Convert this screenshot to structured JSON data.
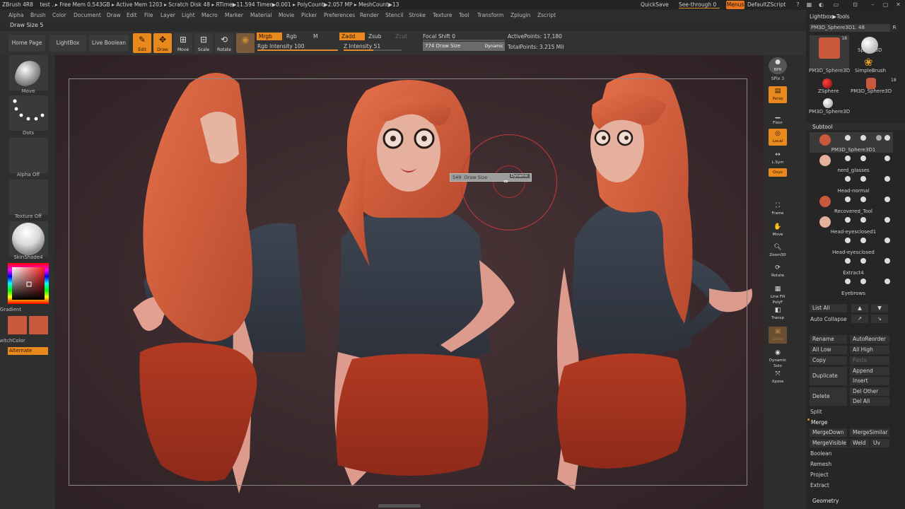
{
  "titlebar": {
    "app": "ZBrush 4R8",
    "project": "test",
    "free_mem": "Free Mem 0.543GB",
    "active_mem": "Active Mem 1203",
    "scratch": "Scratch Disk 48",
    "rtime": "RTime▶11.594 Timer▶0.001",
    "polycount": "PolyCount▶2.057 MP",
    "meshcount": "MeshCount▶13",
    "quicksave": "QuickSave",
    "see_through": "See-through  0",
    "menus": "Menus",
    "default_script": "DefaultZScript"
  },
  "menubar": [
    "Alpha",
    "Brush",
    "Color",
    "Document",
    "Draw",
    "Edit",
    "File",
    "Layer",
    "Light",
    "Macro",
    "Marker",
    "Material",
    "Movie",
    "Picker",
    "Preferences",
    "Render",
    "Stencil",
    "Stroke",
    "Texture",
    "Tool",
    "Transform",
    "Zplugin",
    "Zscript"
  ],
  "info": {
    "draw_size": "Draw Size 5"
  },
  "shelf": {
    "home": "Home Page",
    "lightbox": "LightBox",
    "live_boolean": "Live Boolean",
    "edit": "Edit",
    "draw": "Draw",
    "move": "Move",
    "scale": "Scale",
    "rotate": "Rotate",
    "mrgb": "Mrgb",
    "rgb": "Rgb",
    "m": "M",
    "zadd": "Zadd",
    "zsub": "Zsub",
    "zcut": "Zcut",
    "rgb_intensity": "Rgb Intensity 100",
    "rgb_intensity_value": 100,
    "z_intensity": "Z Intensity 51",
    "z_intensity_value": 51,
    "focal_shift": "Focal Shift  0",
    "draw_size_field": "774  Draw Size",
    "dynamic": "Dynamic",
    "active_points": "ActivePoints: 17,180",
    "total_points": "TotalPoints: 3.215 Mil"
  },
  "leftcol": {
    "move": "Move",
    "dots": "Dots",
    "alpha": "Alpha Off",
    "texture": "Texture Off",
    "material": "SkinShade4",
    "gradient": "Gradient",
    "switch_color": "SwitchColor",
    "alternate": "Alternate"
  },
  "popup": {
    "value": "549",
    "label": "Draw Size",
    "dynamic": "Dynamic"
  },
  "rightbar": [
    "BPR",
    "SPix 3",
    "Persp",
    "Floor",
    "Local",
    "L.Sym",
    "Qxyz",
    "Frame",
    "Move",
    "Zoom3D",
    "Rotate",
    "Line Fill PolyF",
    "Transp",
    "Ghost",
    "Dynamic Solo",
    "Xpose"
  ],
  "tray": {
    "breadcrumb": "Lightbox▶Tools",
    "current_tool": "PM3D_Sphere3D1. 48",
    "r": "R",
    "tools": [
      {
        "label": "PM3D_Sphere3D",
        "count": "18"
      },
      {
        "label": "Sphere3D"
      },
      {
        "label": "SimpleBrush"
      },
      {
        "label": "ZSphere"
      },
      {
        "label": "PM3D_Sphere3D",
        "count": "18"
      },
      {
        "label": "PM3D_Sphere3D"
      }
    ],
    "subtool_title": "Subtool",
    "subtools": [
      "PM3D_Sphere3D1",
      "nerd_glasses",
      "Head-normal",
      "Recovered_Tool",
      "Head-eyesclosed1",
      "Head-eyesclosed",
      "Extract4",
      "Eyebrows"
    ],
    "list_all": "List All",
    "auto_collapse": "Auto Collapse",
    "rename": "Rename",
    "autoreorder": "AutoReorder",
    "all_low": "All Low",
    "all_high": "All High",
    "copy": "Copy",
    "paste": "Paste",
    "duplicate": "Duplicate",
    "append": "Append",
    "insert": "Insert",
    "delete": "Delete",
    "del_other": "Del Other",
    "del_all": "Del All",
    "split": "Split",
    "merge": "Merge",
    "merge_down": "MergeDown",
    "merge_similar": "MergeSimilar",
    "merge_visible": "MergeVisible",
    "weld": "Weld",
    "uv": "Uv",
    "boolean": "Boolean",
    "remesh": "Remesh",
    "project": "Project",
    "extract": "Extract",
    "geometry": "Geometry"
  }
}
